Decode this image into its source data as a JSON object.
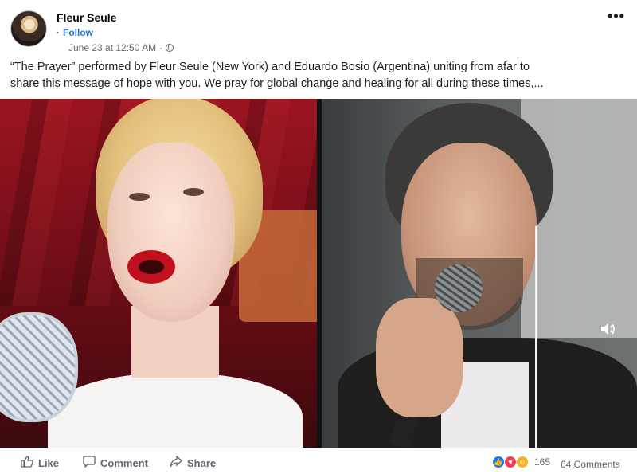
{
  "post": {
    "author": "Fleur Seule",
    "follow_separator": "·",
    "follow_label": "Follow",
    "timestamp": "June 23 at 12:50 AM",
    "timestamp_separator": "·",
    "privacy_icon": "globe-icon",
    "more_label": "•••",
    "caption_line1": "“The Prayer” performed by Fleur Seule (New York) and Eduardo Bosio (Argentina) uniting from afar to",
    "caption_line2_before": "share this message of hope with you. We pray for global change and healing for ",
    "caption_line2_underlined": "all",
    "caption_line2_after": " during these times,..."
  },
  "video": {
    "volume_icon": "speaker-icon"
  },
  "actions": {
    "like_label": "Like",
    "comment_label": "Comment",
    "share_label": "Share",
    "reactions_count": "165",
    "comments_count": "64 Comments"
  },
  "colors": {
    "link": "#216fdb",
    "muted": "#606770",
    "like": "#1877f2",
    "love": "#f33e58",
    "care": "#f7b125"
  }
}
